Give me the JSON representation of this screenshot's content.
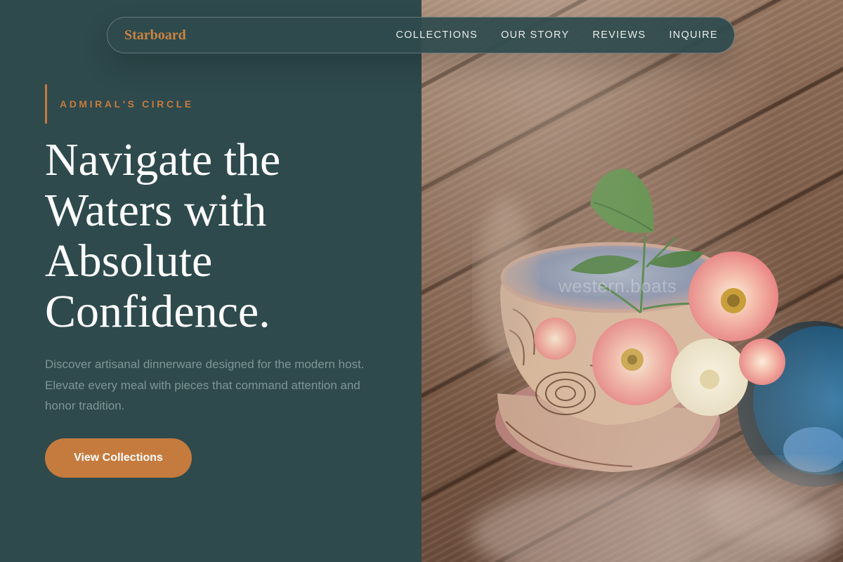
{
  "nav": {
    "brand": "Starboard",
    "links": [
      "COLLECTIONS",
      "OUR STORY",
      "REVIEWS",
      "INQUIRE"
    ]
  },
  "hero": {
    "eyebrow": "ADMIRAL'S CIRCLE",
    "headline": "Navigate the Waters with Absolute Confidence.",
    "description": "Discover artisanal dinnerware designed for the modern host. Elevate every meal with pieces that command attention and honor tradition.",
    "cta_label": "View Collections"
  },
  "image": {
    "description_icon": "photo-ceramic-bowls-with-roses",
    "watermark": "western.boats"
  },
  "colors": {
    "background": "#2e4a4d",
    "accent": "#c67b3e",
    "brand": "#c98442",
    "muted_text": "#7f9596"
  }
}
